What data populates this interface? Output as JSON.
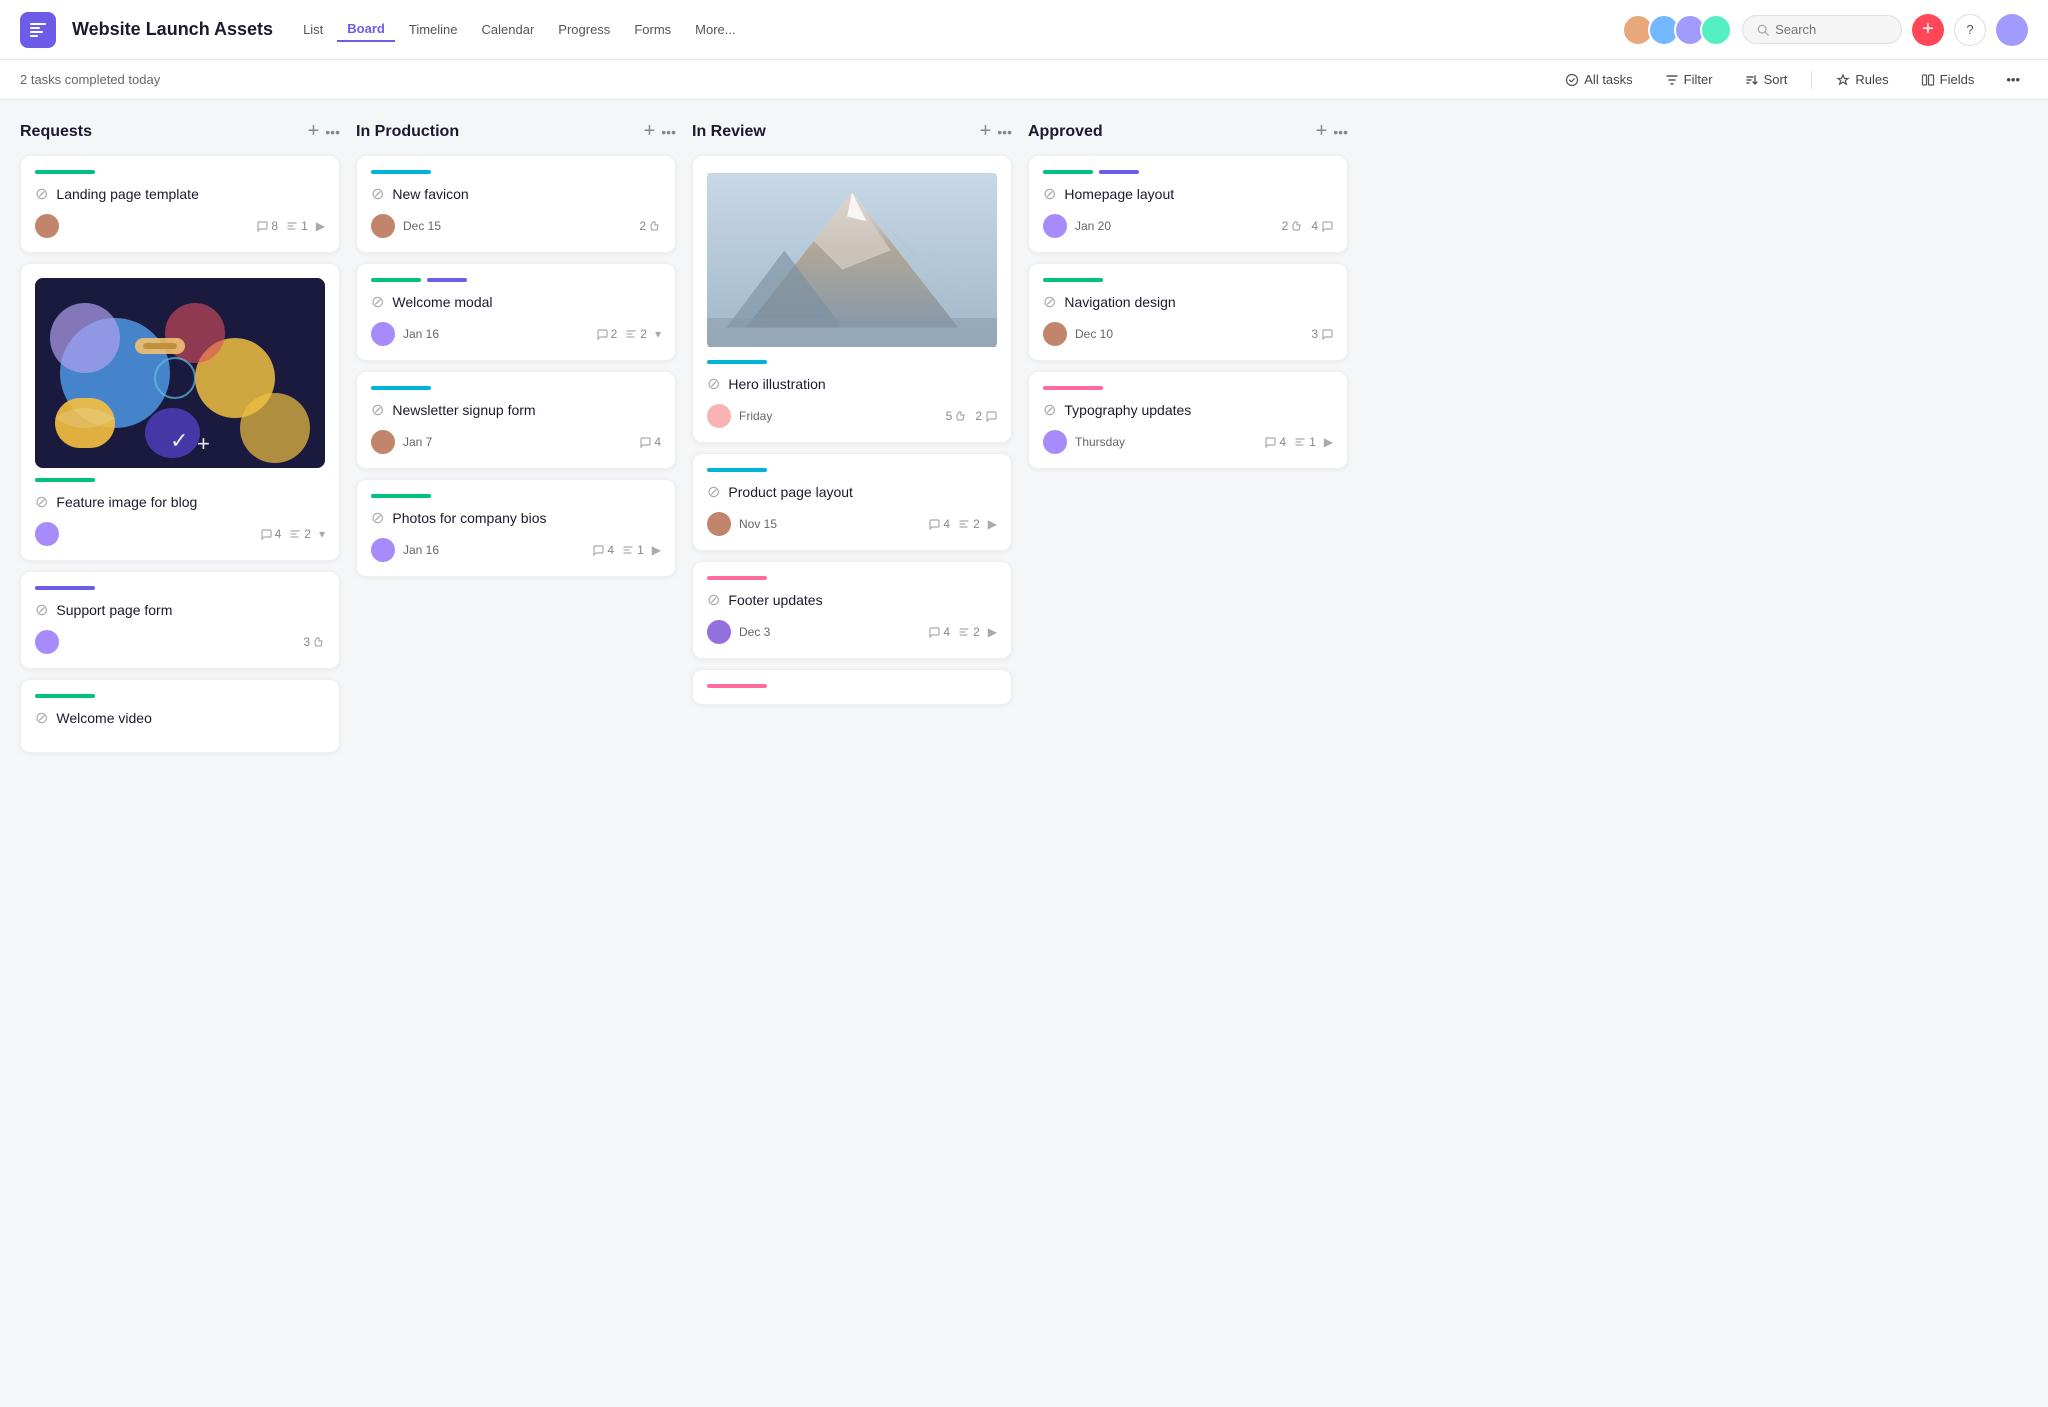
{
  "header": {
    "app_icon": "📋",
    "project_title": "Website Launch Assets",
    "nav_items": [
      "List",
      "Board",
      "Timeline",
      "Calendar",
      "Progress",
      "Forms",
      "More..."
    ],
    "active_nav": "Board",
    "search_placeholder": "Search",
    "btn_add_label": "+",
    "btn_help_label": "?"
  },
  "toolbar": {
    "status_text": "2 tasks completed today",
    "all_tasks_label": "All tasks",
    "filter_label": "Filter",
    "sort_label": "Sort",
    "rules_label": "Rules",
    "fields_label": "Fields"
  },
  "columns": [
    {
      "id": "requests",
      "title": "Requests",
      "cards": [
        {
          "id": "landing-page",
          "color": "#00c27c",
          "title": "Landing page template",
          "date": "",
          "comments": 8,
          "subtasks": 1,
          "avatar_color": "#c0856a",
          "has_arrow": true,
          "has_image": false
        },
        {
          "id": "feature-image",
          "color": "#00c27c",
          "title": "Feature image for blog",
          "date": "",
          "comments": 4,
          "subtasks": 2,
          "avatar_color": "#a78bfa",
          "has_arrow": false,
          "has_dropdown": true,
          "has_colorful_image": true
        },
        {
          "id": "support-page",
          "color": "#6c5ce7",
          "title": "Support page form",
          "date": "",
          "comments": 0,
          "likes": 3,
          "avatar_color": "#a78bfa",
          "has_arrow": false
        },
        {
          "id": "welcome-video",
          "color": "#00c27c",
          "title": "Welcome video",
          "date": "",
          "comments": 0,
          "avatar_color": "",
          "has_arrow": false
        }
      ]
    },
    {
      "id": "in-production",
      "title": "In Production",
      "cards": [
        {
          "id": "new-favicon",
          "color": "#00b4d8",
          "title": "New favicon",
          "date": "Dec 15",
          "likes": 2,
          "avatar_color": "#c0856a",
          "has_arrow": false
        },
        {
          "id": "welcome-modal",
          "color_double": true,
          "color1": "#00c27c",
          "color2": "#6c5ce7",
          "title": "Welcome modal",
          "date": "Jan 16",
          "comments": 2,
          "subtasks": 2,
          "avatar_color": "#a78bfa",
          "has_dropdown": true
        },
        {
          "id": "newsletter-signup",
          "color": "#00b4d8",
          "title": "Newsletter signup form",
          "date": "Jan 7",
          "comments": 4,
          "avatar_color": "#c0856a",
          "has_arrow": false
        },
        {
          "id": "photos-bios",
          "color": "#00c27c",
          "title": "Photos for company bios",
          "date": "Jan 16",
          "comments": 4,
          "subtasks": 1,
          "avatar_color": "#a78bfa",
          "has_arrow": true
        }
      ]
    },
    {
      "id": "in-review",
      "title": "In Review",
      "cards": [
        {
          "id": "hero-illustration",
          "color": "#00b4d8",
          "title": "Hero illustration",
          "date": "Friday",
          "likes": 5,
          "comments": 2,
          "avatar_color": "#f8b4b4",
          "has_mountain_image": true
        },
        {
          "id": "product-page",
          "color": "#00b4d8",
          "title": "Product page layout",
          "date": "Nov 15",
          "comments": 4,
          "subtasks": 2,
          "avatar_color": "#c0856a",
          "has_arrow": true
        },
        {
          "id": "footer-updates",
          "color": "#ff6b9d",
          "title": "Footer updates",
          "date": "Dec 3",
          "comments": 4,
          "subtasks": 2,
          "avatar_color": "#9370db",
          "has_arrow": true
        },
        {
          "id": "in-review-bottom",
          "color": "#ff6b9d",
          "title": "",
          "date": "",
          "comments": 0
        }
      ]
    },
    {
      "id": "approved",
      "title": "Approved",
      "cards": [
        {
          "id": "homepage-layout",
          "color_double": true,
          "color1": "#00c27c",
          "color2": "#6c5ce7",
          "title": "Homepage layout",
          "date": "Jan 20",
          "likes": 2,
          "comments": 4,
          "avatar_color": "#a78bfa"
        },
        {
          "id": "navigation-design",
          "color": "#00c27c",
          "title": "Navigation design",
          "date": "Dec 10",
          "comments": 3,
          "avatar_color": "#c0856a"
        },
        {
          "id": "typography-updates",
          "color": "#ff6b9d",
          "title": "Typography updates",
          "date": "Thursday",
          "comments": 4,
          "subtasks": 1,
          "avatar_color": "#a78bfa",
          "has_arrow": true
        }
      ]
    }
  ]
}
